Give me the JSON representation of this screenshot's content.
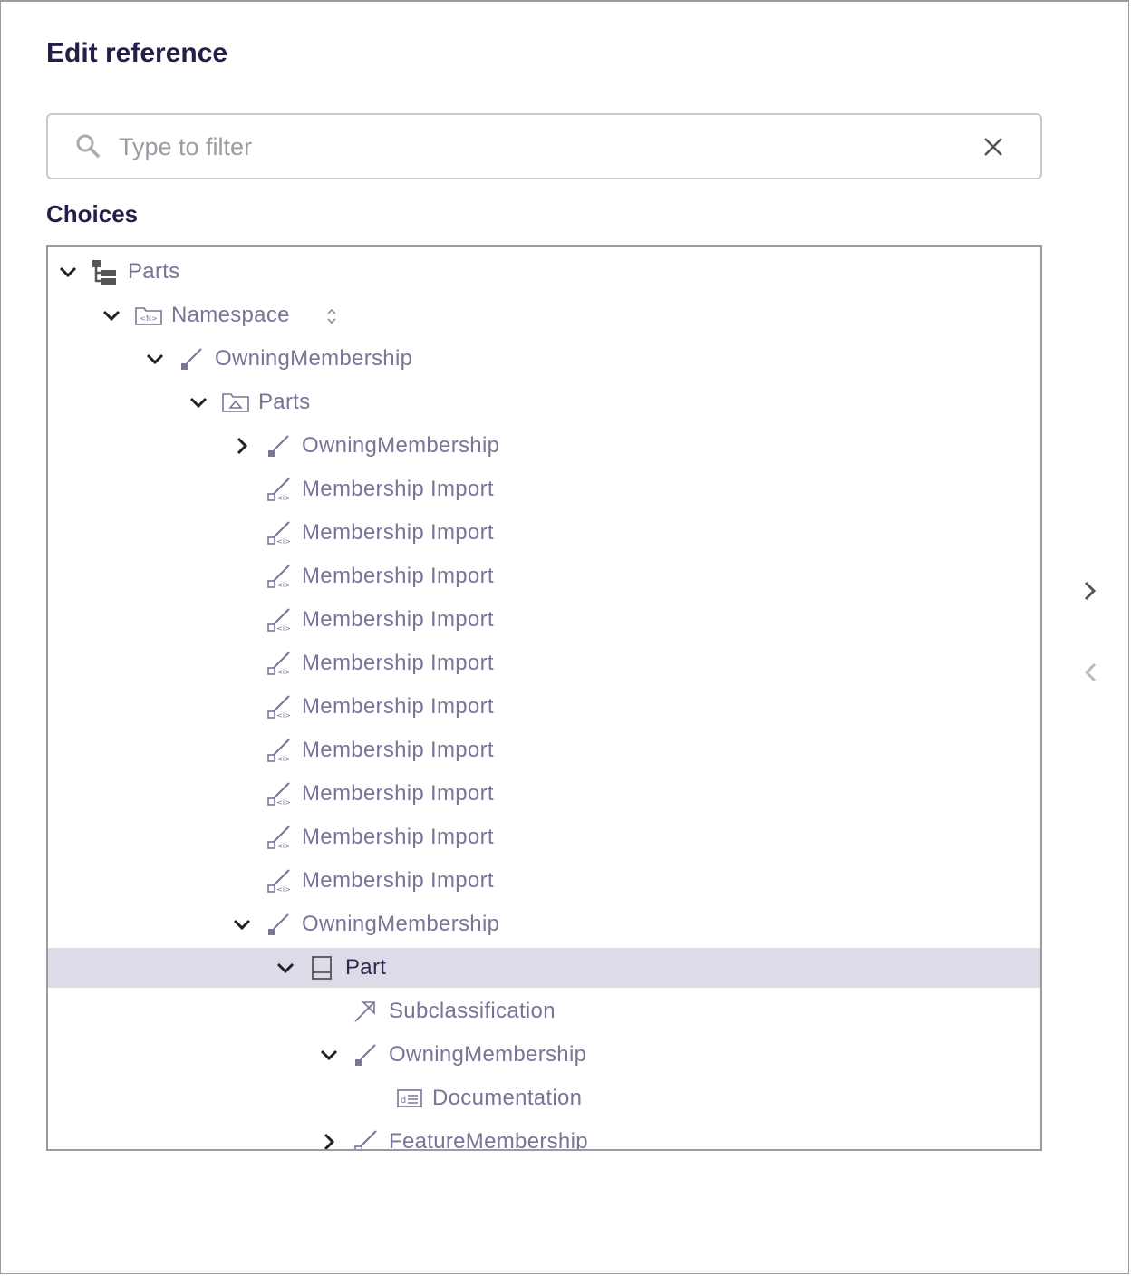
{
  "dialog": {
    "title": "Edit reference",
    "filter": {
      "placeholder": "Type to filter",
      "value": ""
    },
    "choices_label": "Choices"
  },
  "tree": [
    {
      "label": "Parts",
      "depth": 0,
      "expander": "expanded",
      "icon": "root-tree-icon",
      "selected": false
    },
    {
      "label": "Namespace",
      "depth": 1,
      "expander": "expanded",
      "icon": "namespace-icon",
      "selected": false,
      "sortable": true
    },
    {
      "label": "OwningMembership",
      "depth": 2,
      "expander": "expanded",
      "icon": "membership-icon",
      "selected": false
    },
    {
      "label": "Parts",
      "depth": 3,
      "expander": "expanded",
      "icon": "package-icon",
      "selected": false
    },
    {
      "label": "OwningMembership",
      "depth": 4,
      "expander": "collapsed",
      "icon": "membership-icon",
      "selected": false
    },
    {
      "label": "Membership Import",
      "depth": 4,
      "expander": "none",
      "icon": "membership-import-icon",
      "selected": false
    },
    {
      "label": "Membership Import",
      "depth": 4,
      "expander": "none",
      "icon": "membership-import-icon",
      "selected": false
    },
    {
      "label": "Membership Import",
      "depth": 4,
      "expander": "none",
      "icon": "membership-import-icon",
      "selected": false
    },
    {
      "label": "Membership Import",
      "depth": 4,
      "expander": "none",
      "icon": "membership-import-icon",
      "selected": false
    },
    {
      "label": "Membership Import",
      "depth": 4,
      "expander": "none",
      "icon": "membership-import-icon",
      "selected": false
    },
    {
      "label": "Membership Import",
      "depth": 4,
      "expander": "none",
      "icon": "membership-import-icon",
      "selected": false
    },
    {
      "label": "Membership Import",
      "depth": 4,
      "expander": "none",
      "icon": "membership-import-icon",
      "selected": false
    },
    {
      "label": "Membership Import",
      "depth": 4,
      "expander": "none",
      "icon": "membership-import-icon",
      "selected": false
    },
    {
      "label": "Membership Import",
      "depth": 4,
      "expander": "none",
      "icon": "membership-import-icon",
      "selected": false
    },
    {
      "label": "Membership Import",
      "depth": 4,
      "expander": "none",
      "icon": "membership-import-icon",
      "selected": false
    },
    {
      "label": "OwningMembership",
      "depth": 4,
      "expander": "expanded",
      "icon": "membership-icon",
      "selected": false
    },
    {
      "label": "Part",
      "depth": 5,
      "expander": "expanded",
      "icon": "part-icon",
      "selected": true
    },
    {
      "label": "Subclassification",
      "depth": 6,
      "expander": "none",
      "icon": "subclassification-icon",
      "selected": false
    },
    {
      "label": "OwningMembership",
      "depth": 6,
      "expander": "expanded",
      "icon": "membership-icon",
      "selected": false
    },
    {
      "label": "Documentation",
      "depth": 7,
      "expander": "none",
      "icon": "documentation-icon",
      "selected": false
    },
    {
      "label": "FeatureMembership",
      "depth": 6,
      "expander": "collapsed",
      "icon": "feature-membership-icon",
      "selected": false
    }
  ],
  "colors": {
    "title": "#261e48",
    "label": "#7a7498",
    "selected_bg": "#dcdce8",
    "icon": "#7a7498"
  }
}
